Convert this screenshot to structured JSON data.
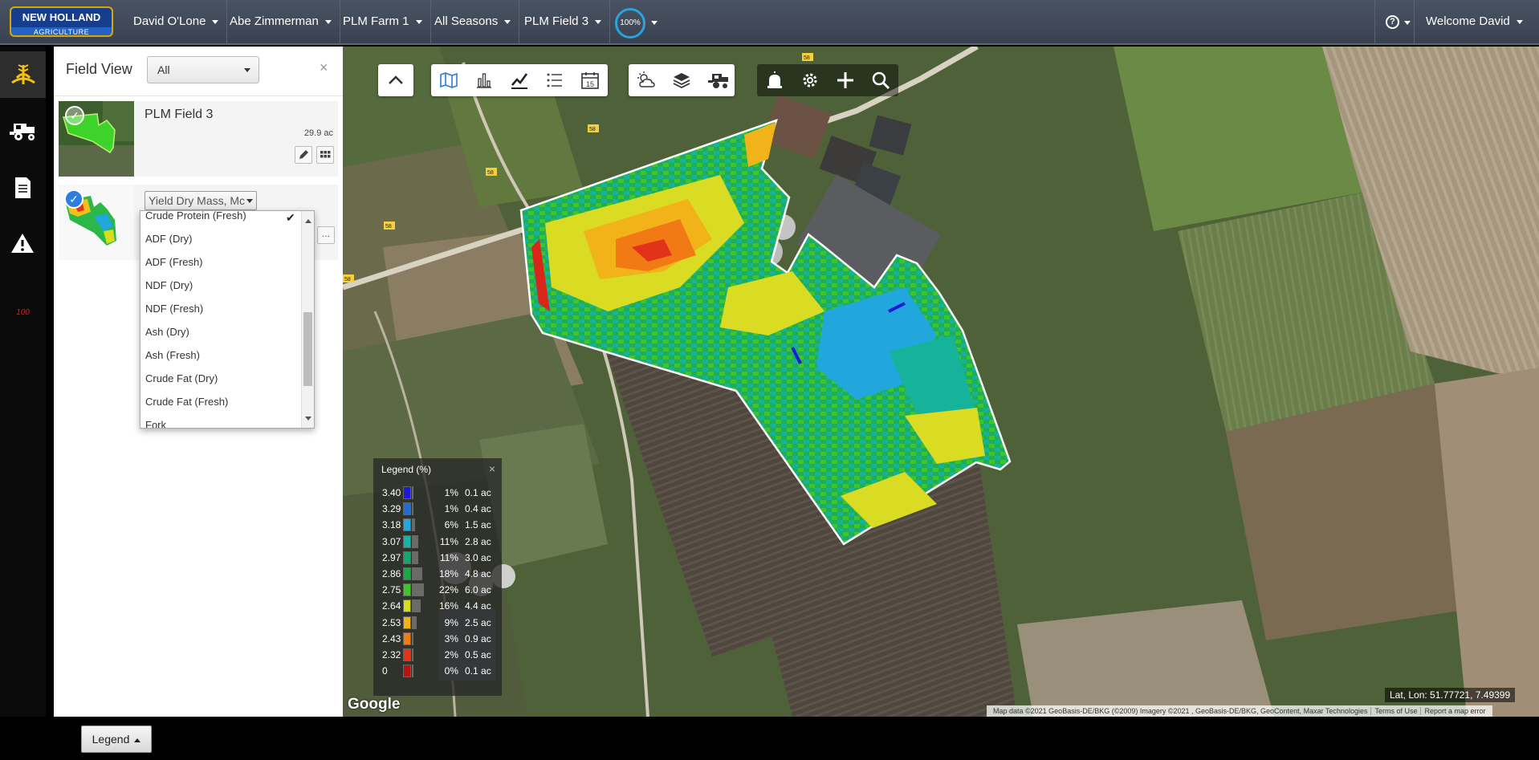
{
  "topbar": {
    "logo_main": "NEW HOLLAND",
    "logo_sub": "AGRICULTURE",
    "crumbs": [
      "David O'Lone",
      "Abe Zimmerman",
      "PLM Farm 1",
      "All Seasons",
      "PLM Field 3"
    ],
    "progress_label": "100%",
    "progress_value": 1.0,
    "help_label": "?",
    "welcome": "Welcome David"
  },
  "sidebar": {
    "items": [
      {
        "icon": "wheat-icon",
        "label": ""
      },
      {
        "icon": "combine-icon",
        "label": ""
      },
      {
        "icon": "document-icon",
        "label": ""
      },
      {
        "icon": "alert-icon",
        "label": ""
      }
    ],
    "alert_count": "100"
  },
  "panel": {
    "title": "Field View",
    "filter_value": "All",
    "close_label": "×",
    "field": {
      "name": "PLM Field 3",
      "area": "29.9 ac"
    },
    "layer": {
      "selected": "Yield Dry Mass, Mc",
      "more_label": "...",
      "options": [
        "Crude Protein (Fresh)",
        "ADF (Dry)",
        "ADF (Fresh)",
        "NDF (Dry)",
        "NDF (Fresh)",
        "Ash (Dry)",
        "Ash (Fresh)",
        "Crude Fat (Dry)",
        "Crude Fat (Fresh)",
        "Fork"
      ],
      "checked_option": "Crude Protein (Fresh)"
    }
  },
  "map": {
    "toolbar_groups": [
      [
        "chevron-up-icon"
      ],
      [
        "map-book-icon",
        "bar-chart-icon",
        "line-chart-icon",
        "list-icon",
        "calendar-icon"
      ],
      [
        "weather-icon",
        "layers-icon",
        "machines-icon"
      ],
      [
        "alarm-icon",
        "settings-icon",
        "add-icon",
        "search-icon"
      ]
    ],
    "calendar_day": "15",
    "right_controls": [
      "locate-icon",
      "rotate-icon",
      "zoom-in-icon",
      "zoom-out-icon",
      "globe-icon"
    ],
    "road_labels": [
      "58",
      "58",
      "58",
      "58",
      "58",
      "58"
    ],
    "legend": {
      "title": "Legend (%)",
      "close_label": "×",
      "rows": [
        {
          "value": "3.40",
          "color": "#1b1bd6",
          "pct": "1%",
          "area": "0.1 ac",
          "frac": 0.01
        },
        {
          "value": "3.29",
          "color": "#1f6fd1",
          "pct": "1%",
          "area": "0.4 ac",
          "frac": 0.01
        },
        {
          "value": "3.18",
          "color": "#21a7dd",
          "pct": "6%",
          "area": "1.5 ac",
          "frac": 0.06
        },
        {
          "value": "3.07",
          "color": "#17b3a3",
          "pct": "11%",
          "area": "2.8 ac",
          "frac": 0.11
        },
        {
          "value": "2.97",
          "color": "#12a86d",
          "pct": "11%",
          "area": "3.0 ac",
          "frac": 0.11
        },
        {
          "value": "2.86",
          "color": "#1aa845",
          "pct": "18%",
          "area": "4.8 ac",
          "frac": 0.18
        },
        {
          "value": "2.75",
          "color": "#3fc42c",
          "pct": "22%",
          "area": "6.0 ac",
          "frac": 0.22
        },
        {
          "value": "2.64",
          "color": "#d6dc1e",
          "pct": "16%",
          "area": "4.4 ac",
          "frac": 0.16
        },
        {
          "value": "2.53",
          "color": "#f2b21a",
          "pct": "9%",
          "area": "2.5 ac",
          "frac": 0.09
        },
        {
          "value": "2.43",
          "color": "#f27a14",
          "pct": "3%",
          "area": "0.9 ac",
          "frac": 0.03
        },
        {
          "value": "2.32",
          "color": "#e2331a",
          "pct": "2%",
          "area": "0.5 ac",
          "frac": 0.02
        },
        {
          "value": "0",
          "color": "#b8150f",
          "pct": "0%",
          "area": "0.1 ac",
          "frac": 0.0
        }
      ]
    },
    "google_logo": "Google",
    "latlon": "Lat, Lon: 51.77721, 7.49399",
    "attribution": [
      "Map data ©2021 GeoBasis-DE/BKG (©2009) Imagery ©2021 , GeoBasis-DE/BKG, GeoContent, Maxar Technologies",
      "Terms of Use",
      "Report a map error"
    ]
  },
  "bottombar": {
    "legend_button": "Legend"
  }
}
